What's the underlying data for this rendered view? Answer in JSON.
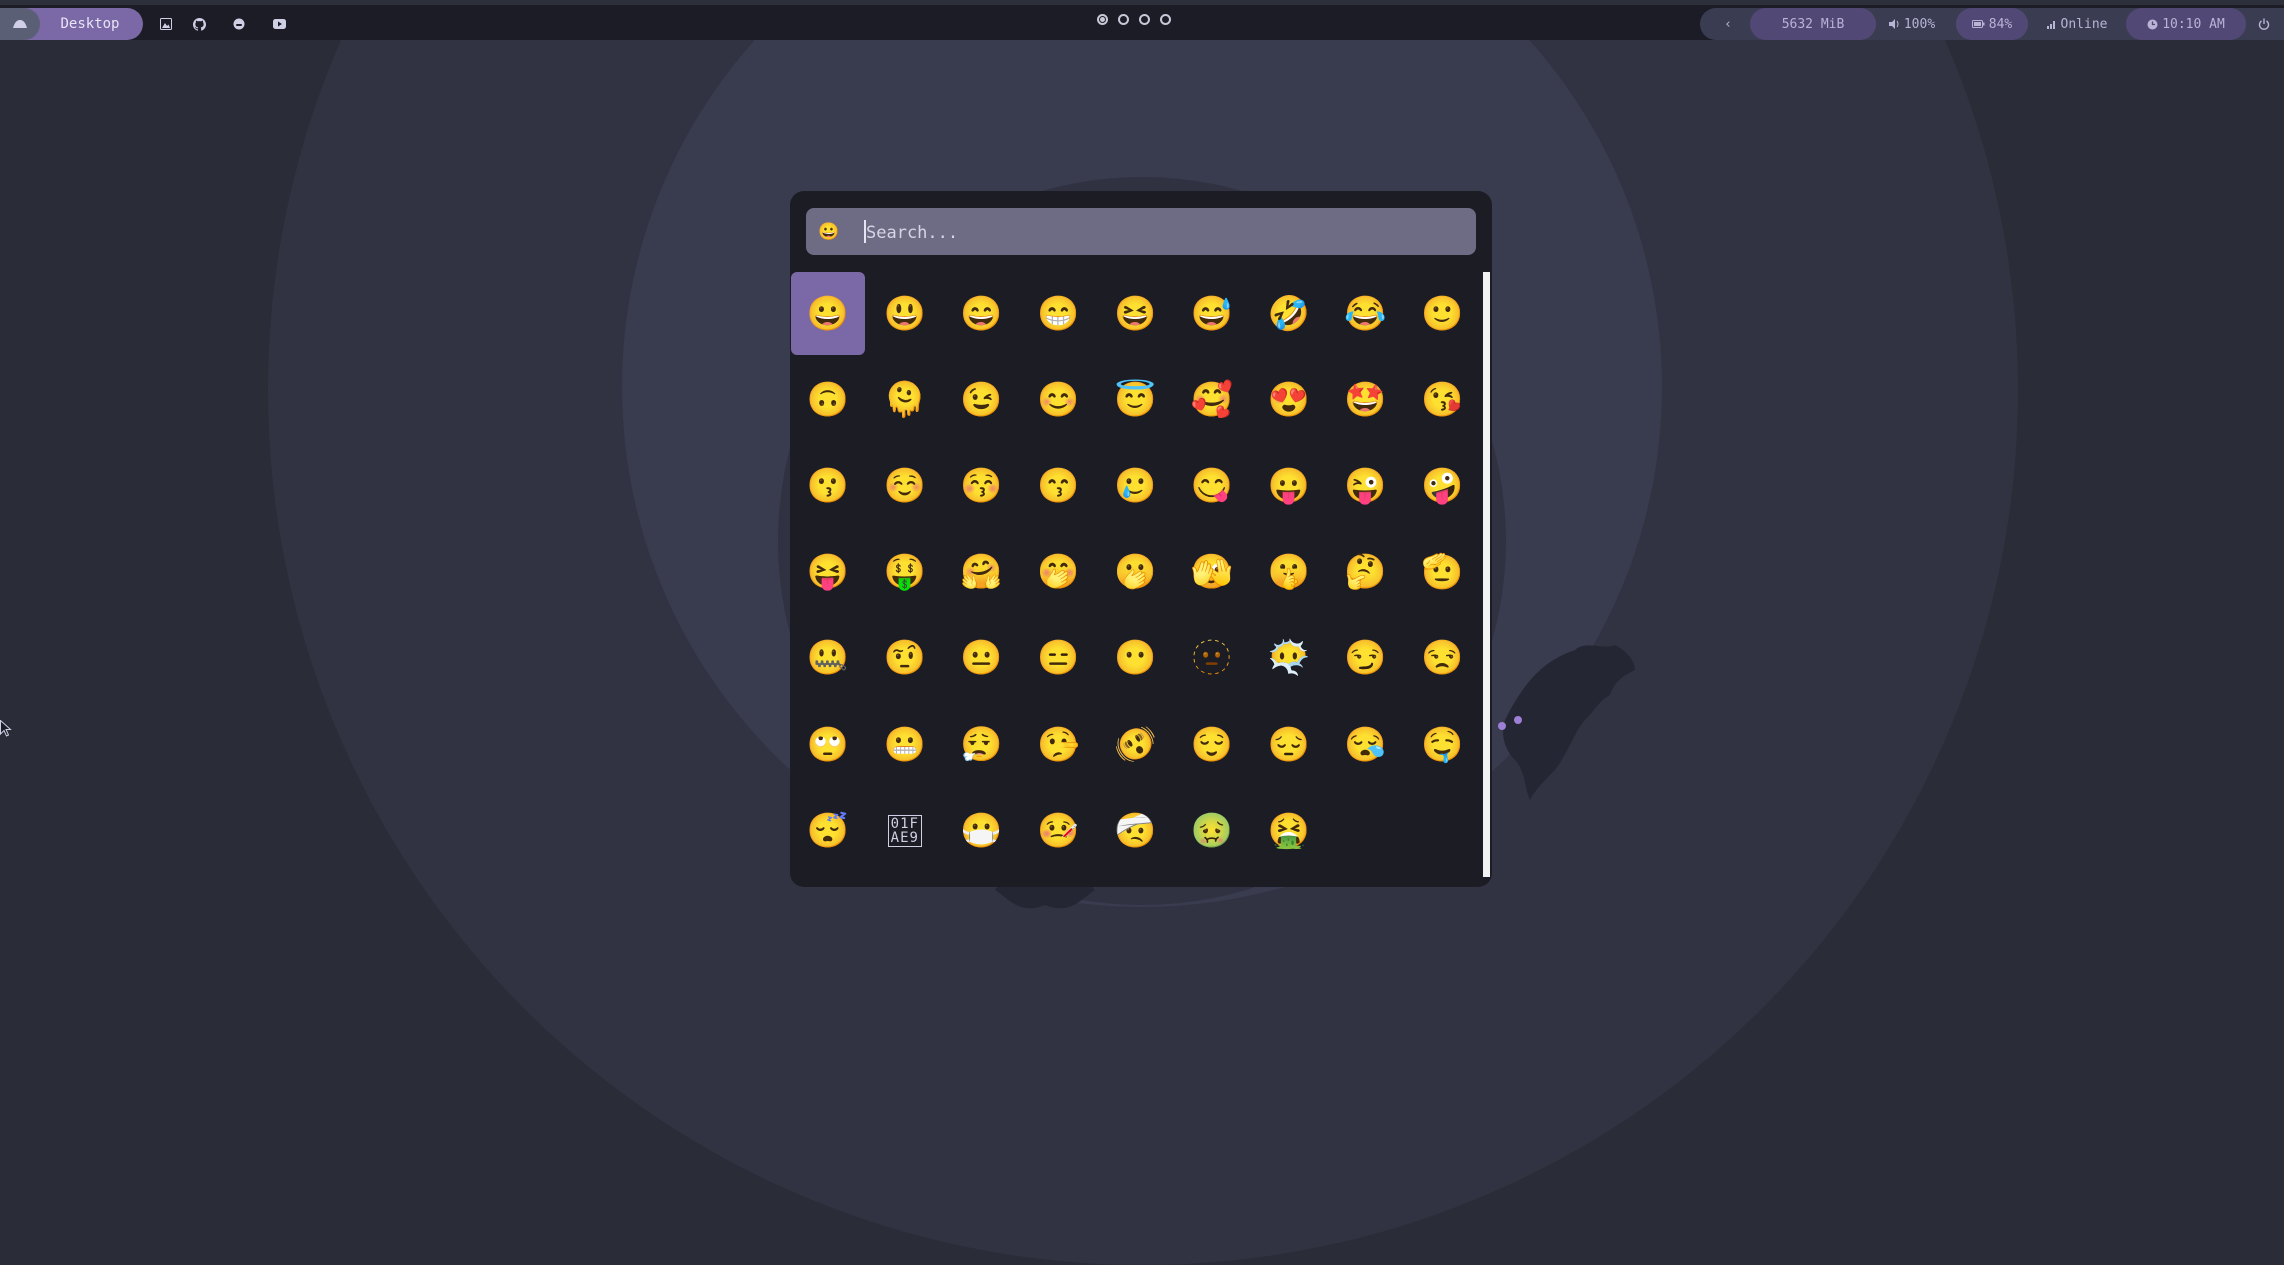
{
  "topbar": {
    "workspace_label": "Desktop",
    "app_icons": [
      "image-icon",
      "github-icon",
      "reddit-icon",
      "youtube-icon"
    ],
    "workspace_dots": [
      true,
      false,
      false,
      false
    ],
    "collapse_glyph": "‹",
    "memory": "5632 MiB",
    "volume": "100%",
    "battery": "84%",
    "network": "Online",
    "clock": "10:10 AM"
  },
  "picker": {
    "search_icon": "😀",
    "search_placeholder": "Search...",
    "selected_index": 0,
    "emojis": [
      "😀",
      "😃",
      "😄",
      "😁",
      "😆",
      "😅",
      "🤣",
      "😂",
      "🙂",
      "🙃",
      "🫠",
      "😉",
      "😊",
      "😇",
      "🥰",
      "😍",
      "🤩",
      "😘",
      "😗",
      "☺️",
      "😚",
      "😙",
      "🥲",
      "😋",
      "😛",
      "😜",
      "🤪",
      "😝",
      "🤑",
      "🤗",
      "🤭",
      "🫢",
      "🫣",
      "🤫",
      "🤔",
      "🫡",
      "🤐",
      "🤨",
      "😐",
      "😑",
      "😶",
      "🫥",
      "😶‍🌫️",
      "😏",
      "😒",
      "🙄",
      "😬",
      "😮‍💨",
      "🤥",
      "🫨",
      "😌",
      "😔",
      "😪",
      "🤤",
      "😴",
      "01F\nAE9",
      "😷",
      "🤒",
      "🤕",
      "🤢",
      "🤮"
    ]
  },
  "colors": {
    "accent": "#7b68a6",
    "bar_bg": "#1b1c25",
    "picker_bg": "#1c1c24",
    "search_bg": "#6e6c85",
    "wallpaper": "#2a2c38"
  }
}
